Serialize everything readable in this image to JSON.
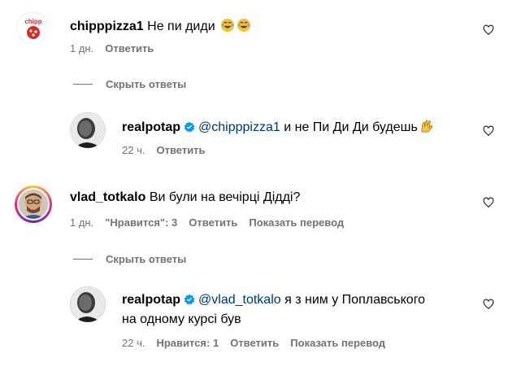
{
  "comments": [
    {
      "username": "chipppizza1",
      "text": "Не пи диди",
      "time": "1 дн.",
      "reply": "Ответить"
    },
    {
      "username": "realpotap",
      "mention": "@chipppizza1",
      "text": "и не Пи Ди Ди будешь",
      "time": "22 ч.",
      "reply": "Ответить"
    },
    {
      "username": "vlad_totkalo",
      "text": "Ви були на вечірці Дідді?",
      "time": "1 дн.",
      "likes": "\"Нравится\": 3",
      "reply": "Ответить",
      "translate": "Показать перевод"
    },
    {
      "username": "realpotap",
      "mention": "@vlad_totkalo",
      "text_line1": "я з ним у Поплавського",
      "text_line2": "на одному курсі був",
      "time": "22 ч.",
      "likes": "Нравится: 1",
      "reply": "Ответить",
      "translate": "Показать перевод"
    }
  ],
  "toggles": {
    "hide_replies_1": "Скрыть ответы",
    "hide_replies_2": "Скрыть ответы"
  },
  "colors": {
    "secondary_text": "#737373",
    "mention": "#00376b",
    "verified": "#0095f6"
  }
}
